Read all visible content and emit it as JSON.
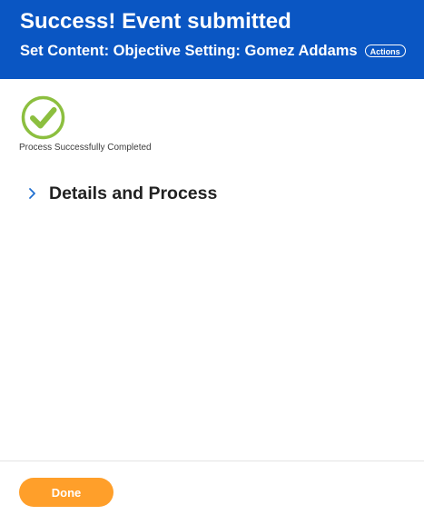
{
  "header": {
    "title": "Success! Event submitted",
    "subtitle": "Set Content: Objective Setting: Gomez Addams",
    "actions_label": "Actions",
    "background_color": "#0a56c3"
  },
  "status": {
    "icon": "check-circle-icon",
    "icon_color": "#8cbf3f",
    "text": "Process Successfully Completed"
  },
  "details": {
    "icon": "chevron-right-icon",
    "label": "Details and Process",
    "expanded": false
  },
  "footer": {
    "done_label": "Done",
    "done_color": "#ff9f2a"
  }
}
